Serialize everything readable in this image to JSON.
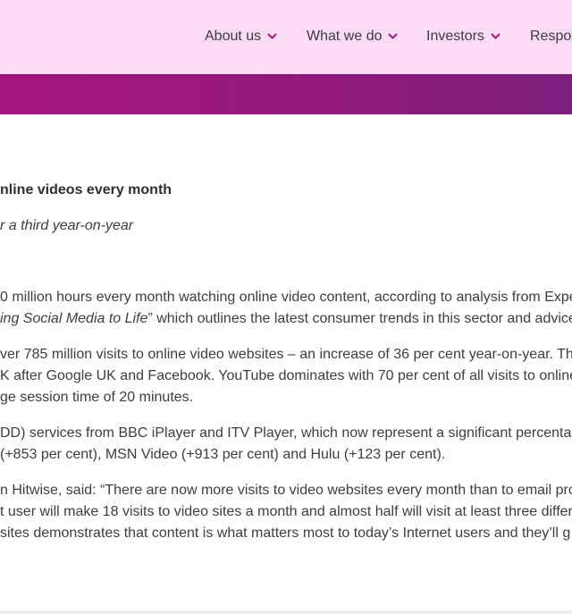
{
  "nav": {
    "items": [
      {
        "label": "About us"
      },
      {
        "label": "What we do"
      },
      {
        "label": "Investors"
      },
      {
        "label": "Respo"
      }
    ]
  },
  "article": {
    "headline": "nline videos every month",
    "subheadline": "r a third year-on-year",
    "p1": {
      "line1": "0 million hours every month watching online video content, according to analysis from Expe",
      "line2_italic": "ing Social Media to Life",
      "line2_rest": "” which outlines the latest consumer trends in this sector and advice"
    },
    "p2": {
      "line1": "ver 785 million visits to online video websites – an increase of 36 per cent year-on-year. The",
      "line2": "K after Google UK and Facebook. YouTube dominates with 70 per cent of all visits to online",
      "line3": "ge session time of 20 minutes."
    },
    "p3": {
      "line1": "DD) services from BBC iPlayer and ITV Player, which now represent a significant percentage",
      "line2": "(+853 per cent), MSN Video (+913 per cent) and Hulu (+123 per cent)."
    },
    "p4": {
      "line1": "n Hitwise, said: “There are now more visits to video websites every month than to email prov",
      "line2": "t user will make 18 visits to video sites a month and almost half will visit at least three differ",
      "line3": "sites demonstrates that content is what matters most to today’s Internet users and they’ll g"
    }
  },
  "colors": {
    "header_bg": "#fbdcf4",
    "banner_start": "#a5157f",
    "banner_end": "#7d1f7e",
    "chevron": "#a0187e",
    "text": "#3d3d42"
  },
  "icons": [
    "chevron-down-icon"
  ]
}
